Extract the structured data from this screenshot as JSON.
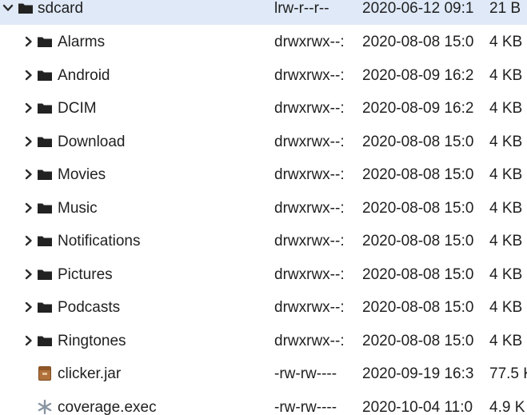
{
  "tree": {
    "root": {
      "name": "sdcard",
      "permissions": "lrw-r--r--",
      "date": "2020-06-12 09:1",
      "size": "21 B",
      "expanded": true,
      "icon": "folder-icon"
    },
    "children": [
      {
        "name": "Alarms",
        "permissions": "drwxrwx--:",
        "date": "2020-08-08 15:0",
        "size": "4 KB",
        "type": "folder",
        "icon": "folder-icon"
      },
      {
        "name": "Android",
        "permissions": "drwxrwx--:",
        "date": "2020-08-09 16:2",
        "size": "4 KB",
        "type": "folder",
        "icon": "folder-icon"
      },
      {
        "name": "DCIM",
        "permissions": "drwxrwx--:",
        "date": "2020-08-09 16:2",
        "size": "4 KB",
        "type": "folder",
        "icon": "folder-icon"
      },
      {
        "name": "Download",
        "permissions": "drwxrwx--:",
        "date": "2020-08-08 15:0",
        "size": "4 KB",
        "type": "folder",
        "icon": "folder-icon"
      },
      {
        "name": "Movies",
        "permissions": "drwxrwx--:",
        "date": "2020-08-08 15:0",
        "size": "4 KB",
        "type": "folder",
        "icon": "folder-icon"
      },
      {
        "name": "Music",
        "permissions": "drwxrwx--:",
        "date": "2020-08-08 15:0",
        "size": "4 KB",
        "type": "folder",
        "icon": "folder-icon"
      },
      {
        "name": "Notifications",
        "permissions": "drwxrwx--:",
        "date": "2020-08-08 15:0",
        "size": "4 KB",
        "type": "folder",
        "icon": "folder-icon"
      },
      {
        "name": "Pictures",
        "permissions": "drwxrwx--:",
        "date": "2020-08-08 15:0",
        "size": "4 KB",
        "type": "folder",
        "icon": "folder-icon"
      },
      {
        "name": "Podcasts",
        "permissions": "drwxrwx--:",
        "date": "2020-08-08 15:0",
        "size": "4 KB",
        "type": "folder",
        "icon": "folder-icon"
      },
      {
        "name": "Ringtones",
        "permissions": "drwxrwx--:",
        "date": "2020-08-08 15:0",
        "size": "4 KB",
        "type": "folder",
        "icon": "folder-icon"
      },
      {
        "name": "clicker.jar",
        "permissions": "-rw-rw----",
        "date": "2020-09-19 16:3",
        "size": "77.5 K",
        "type": "file",
        "icon": "jar-file-icon"
      },
      {
        "name": "coverage.exec",
        "permissions": "-rw-rw----",
        "date": "2020-10-04 11:0",
        "size": "4.9 K",
        "type": "file",
        "icon": "asterisk-file-icon"
      }
    ]
  },
  "colors": {
    "selection": "#dfe9f7",
    "text": "#1f1f1f",
    "folder": "#222222",
    "jar": "#b0713a"
  }
}
